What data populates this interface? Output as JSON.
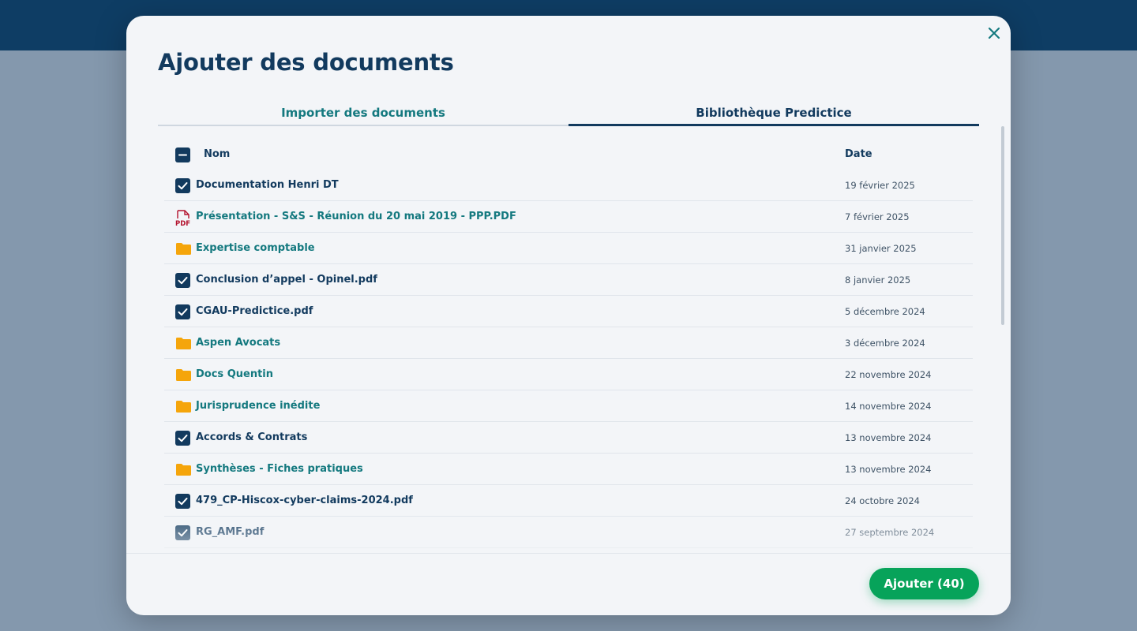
{
  "modal": {
    "title": "Ajouter des documents",
    "close_icon": "close-icon",
    "tabs": [
      {
        "label": "Importer des documents",
        "active": false
      },
      {
        "label": "Bibliothèque Predictice",
        "active": true
      }
    ]
  },
  "table": {
    "header": {
      "name": "Nom",
      "date": "Date",
      "select_all_state": "indeterminate"
    },
    "rows": [
      {
        "type": "file",
        "icon": "checkbox-checked-icon",
        "name": "Documentation Henri DT",
        "date": "19 février 2025"
      },
      {
        "type": "pdf-link",
        "icon": "pdf-icon",
        "name": "Présentation - S&S - Réunion du 20 mai 2019 - PPP.PDF",
        "date": "7 février 2025"
      },
      {
        "type": "folder",
        "icon": "folder-icon",
        "name": "Expertise comptable",
        "date": "31 janvier 2025"
      },
      {
        "type": "file",
        "icon": "checkbox-checked-icon",
        "name": "Conclusion d’appel - Opinel.pdf",
        "date": "8 janvier 2025"
      },
      {
        "type": "file",
        "icon": "checkbox-checked-icon",
        "name": "CGAU-Predictice.pdf",
        "date": "5 décembre 2024"
      },
      {
        "type": "folder",
        "icon": "folder-icon",
        "name": "Aspen Avocats",
        "date": "3 décembre 2024"
      },
      {
        "type": "folder",
        "icon": "folder-icon",
        "name": "Docs Quentin",
        "date": "22 novembre 2024"
      },
      {
        "type": "folder",
        "icon": "folder-icon",
        "name": "Jurisprudence inédite",
        "date": "14 novembre 2024"
      },
      {
        "type": "file",
        "icon": "checkbox-checked-icon",
        "name": "Accords & Contrats",
        "date": "13 novembre 2024"
      },
      {
        "type": "folder",
        "icon": "folder-icon",
        "name": "Synthèses - Fiches pratiques",
        "date": "13 novembre 2024"
      },
      {
        "type": "file",
        "icon": "checkbox-checked-icon",
        "name": "479_CP-Hiscox-cyber-claims-2024.pdf",
        "date": "24 octobre 2024"
      },
      {
        "type": "file",
        "icon": "checkbox-checked-icon",
        "name": "RG_AMF.pdf",
        "date": "27 septembre 2024"
      }
    ]
  },
  "footer": {
    "add_label": "Ajouter (40)"
  },
  "colors": {
    "navy": "#123a5e",
    "teal": "#14797f",
    "folder": "#f5a50b",
    "pdf": "#b3122d",
    "green": "#07a35a",
    "overlay": "#8498ad"
  }
}
